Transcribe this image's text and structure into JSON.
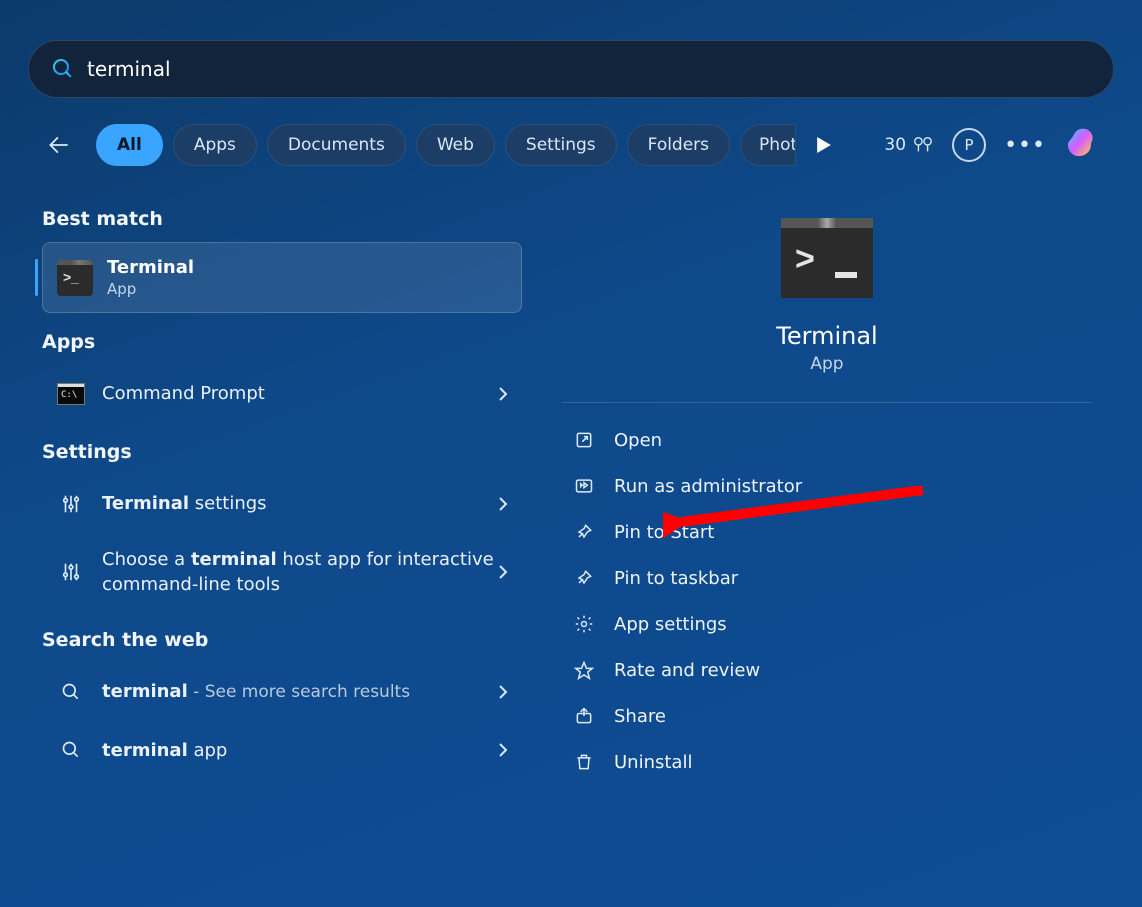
{
  "search": {
    "value": "terminal"
  },
  "filters": {
    "items": [
      "All",
      "Apps",
      "Documents",
      "Web",
      "Settings",
      "Folders",
      "Photos"
    ],
    "active_index": 0
  },
  "header_right": {
    "rewards_points": "30",
    "profile_initial": "P"
  },
  "left": {
    "best_match_heading": "Best match",
    "best": {
      "title": "Terminal",
      "subtitle": "App"
    },
    "apps_heading": "Apps",
    "apps": [
      {
        "label": "Command Prompt"
      }
    ],
    "settings_heading": "Settings",
    "settings": [
      {
        "prefix": "",
        "bold": "Terminal",
        "suffix": " settings"
      },
      {
        "prefix": "Choose a ",
        "bold": "terminal",
        "suffix": " host app for interactive command-line tools"
      }
    ],
    "web_heading": "Search the web",
    "web": [
      {
        "bold": "terminal",
        "muted": " - See more search results"
      },
      {
        "bold": "terminal",
        "plain": " app"
      }
    ]
  },
  "detail": {
    "title": "Terminal",
    "subtitle": "App",
    "actions": [
      {
        "id": "open",
        "label": "Open"
      },
      {
        "id": "runasadmin",
        "label": "Run as administrator"
      },
      {
        "id": "pintostart",
        "label": "Pin to Start"
      },
      {
        "id": "pintotaskbar",
        "label": "Pin to taskbar"
      },
      {
        "id": "appsettings",
        "label": "App settings"
      },
      {
        "id": "rate",
        "label": "Rate and review"
      },
      {
        "id": "share",
        "label": "Share"
      },
      {
        "id": "uninstall",
        "label": "Uninstall"
      }
    ]
  }
}
